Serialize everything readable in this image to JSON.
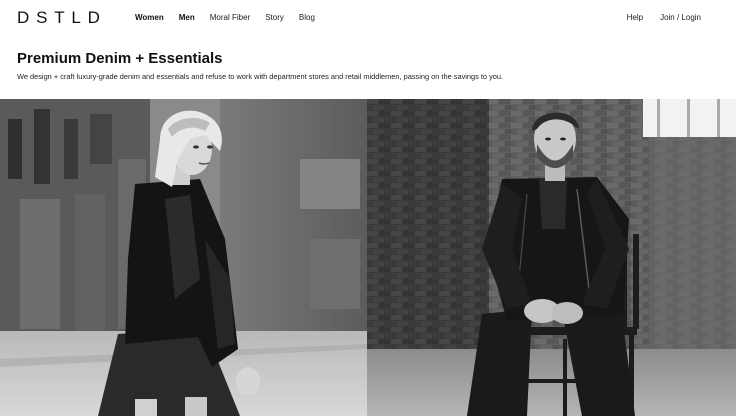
{
  "header": {
    "logo": "DSTLD",
    "nav": [
      {
        "label": "Women"
      },
      {
        "label": "Men"
      },
      {
        "label": "Moral Fiber"
      },
      {
        "label": "Story"
      },
      {
        "label": "Blog"
      }
    ],
    "help_label": "Help",
    "login_label": "Join / Login"
  },
  "intro": {
    "title": "Premium Denim + Essentials",
    "description": "We design + craft luxury-grade denim and essentials and refuse to work with department stores and retail middlemen, passing on the savings to you."
  },
  "hero": {
    "left_photo": "woman-in-leather-jacket-photo",
    "right_photo": "man-in-leather-jacket-photo",
    "style": "black-and-white"
  },
  "colors": {
    "text": "#111111",
    "background": "#ffffff"
  }
}
